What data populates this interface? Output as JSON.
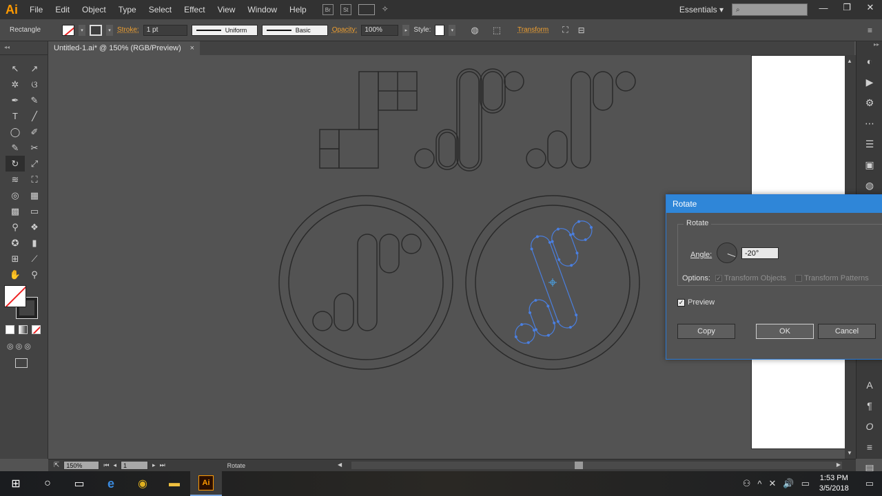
{
  "app": {
    "logo": "Ai"
  },
  "menu": [
    "File",
    "Edit",
    "Object",
    "Type",
    "Select",
    "Effect",
    "View",
    "Window",
    "Help"
  ],
  "menu_icons": {
    "bridge": "Br",
    "stock": "St"
  },
  "workspace": {
    "label": "Essentials",
    "arrow": "▾"
  },
  "window_controls": {
    "minimize": "—",
    "restore": "❐",
    "close": "✕"
  },
  "control_bar": {
    "tool_name": "Rectangle",
    "stroke_label": "Stroke:",
    "stroke_weight": "1 pt",
    "profile": "Uniform",
    "brush": "Basic",
    "opacity_label": "Opacity:",
    "opacity_value": "100%",
    "style_label": "Style:",
    "transform_label": "Transform"
  },
  "tab": {
    "title": "Untitled-1.ai* @ 150% (RGB/Preview)",
    "close": "×"
  },
  "toolbar": {
    "collapse": "◂◂"
  },
  "tools": [
    {
      "name": "selection-tool",
      "glyph": "↖"
    },
    {
      "name": "direct-selection-tool",
      "glyph": "↗"
    },
    {
      "name": "magic-wand-tool",
      "glyph": "✲"
    },
    {
      "name": "lasso-tool",
      "glyph": "ଓ"
    },
    {
      "name": "pen-tool",
      "glyph": "✒"
    },
    {
      "name": "curvature-tool",
      "glyph": "✎"
    },
    {
      "name": "type-tool",
      "glyph": "T"
    },
    {
      "name": "line-tool",
      "glyph": "╱"
    },
    {
      "name": "ellipse-tool",
      "glyph": "◯"
    },
    {
      "name": "paintbrush-tool",
      "glyph": "✐"
    },
    {
      "name": "shaper-tool",
      "glyph": "✎"
    },
    {
      "name": "scissors-tool",
      "glyph": "✂"
    },
    {
      "name": "rotate-tool",
      "glyph": "↻"
    },
    {
      "name": "scale-tool",
      "glyph": "⤢"
    },
    {
      "name": "width-tool",
      "glyph": "≋"
    },
    {
      "name": "free-transform-tool",
      "glyph": "⛶"
    },
    {
      "name": "shape-builder-tool",
      "glyph": "◎"
    },
    {
      "name": "perspective-grid-tool",
      "glyph": "▦"
    },
    {
      "name": "mesh-tool",
      "glyph": "▩"
    },
    {
      "name": "gradient-tool",
      "glyph": "▭"
    },
    {
      "name": "eyedropper-tool",
      "glyph": "⚲"
    },
    {
      "name": "blend-tool",
      "glyph": "❖"
    },
    {
      "name": "symbol-sprayer-tool",
      "glyph": "✪"
    },
    {
      "name": "column-graph-tool",
      "glyph": "▮"
    },
    {
      "name": "artboard-tool",
      "glyph": "⊞"
    },
    {
      "name": "slice-tool",
      "glyph": "⟋"
    },
    {
      "name": "hand-tool",
      "glyph": "✋"
    },
    {
      "name": "zoom-tool",
      "glyph": "⚲"
    }
  ],
  "status": {
    "zoom": "150%",
    "artboard": "1",
    "tool": "Rotate",
    "prev": "◂",
    "next": "▸",
    "first": "⏮",
    "last": "⏭"
  },
  "scroll_arrows": {
    "up": "▲",
    "down": "▼",
    "left": "◀",
    "right": "▶"
  },
  "panels": [
    "◐",
    "▶",
    "⚙",
    "⋯",
    "☰",
    "▣",
    "◍",
    "◉",
    "A",
    "¶",
    "O",
    "≡",
    "▤"
  ],
  "dialog": {
    "title": "Rotate",
    "group_label": "Rotate",
    "angle_label": "Angle:",
    "angle_value": "-20°",
    "options_label": "Options:",
    "transform_objects": "Transform Objects",
    "transform_patterns": "Transform Patterns",
    "preview_label": "Preview",
    "check": "✓",
    "copy": "Copy",
    "ok": "OK",
    "cancel": "Cancel"
  },
  "taskbar": {
    "start": "⊞",
    "search": "○",
    "task_view": "▭",
    "edge": "e",
    "chrome": "◉",
    "explorer": "▬",
    "illustrator": "Ai",
    "time": "1:53 PM",
    "date": "3/5/2018",
    "tray": [
      "⚇",
      "^",
      "✕",
      "🔊",
      "▭"
    ]
  },
  "colors": {
    "accent_orange": "#ff9a00",
    "dialog_blue": "#2f86d8",
    "selection_blue": "#4a7fe0"
  }
}
